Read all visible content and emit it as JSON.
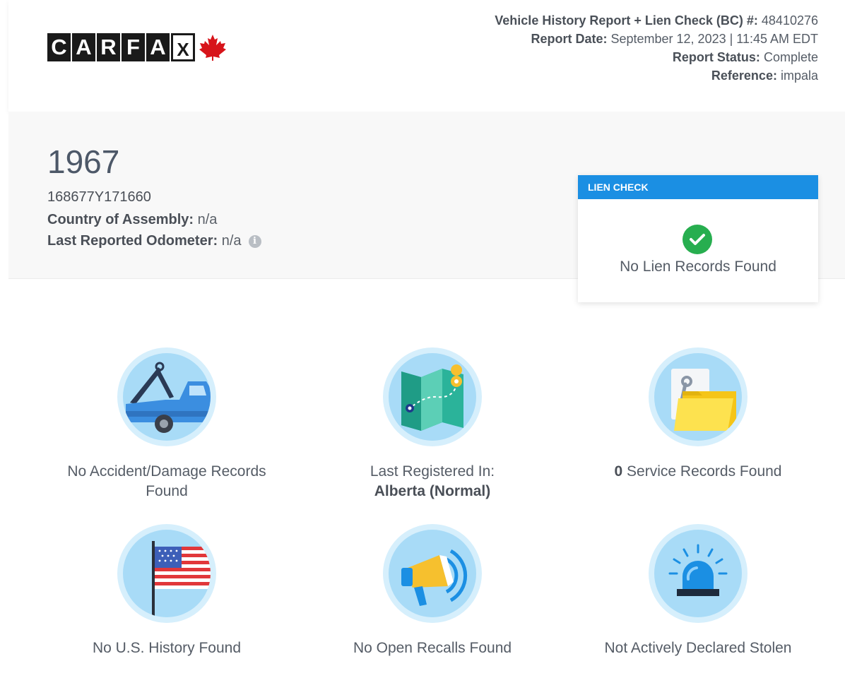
{
  "header": {
    "logo": {
      "letters": [
        "C",
        "A",
        "R",
        "F",
        "A",
        "X"
      ],
      "maple_leaf_color": "#d7141a"
    },
    "report_number_label": "Vehicle History Report + Lien Check (BC) #:",
    "report_number": "48410276",
    "report_date_label": "Report Date:",
    "report_date": "September 12, 2023 | 11:45 AM EDT",
    "report_status_label": "Report Status:",
    "report_status": "Complete",
    "reference_label": "Reference:",
    "reference": "impala"
  },
  "vehicle": {
    "year": "1967",
    "vin": "168677Y171660",
    "country_label": "Country of Assembly:",
    "country": "n/a",
    "odometer_label": "Last Reported Odometer:",
    "odometer": "n/a",
    "info_icon": "info-icon"
  },
  "lien_check": {
    "title": "LIEN CHECK",
    "status_icon": "check-circle-icon",
    "status_text": "No Lien Records Found",
    "accent_color": "#1b8fe3",
    "ok_color": "#27ae4f"
  },
  "cards": [
    {
      "icon": "tow-truck-icon",
      "line1": "No Accident/Damage Records",
      "line2": "Found"
    },
    {
      "icon": "map-icon",
      "line1": "Last Registered In:",
      "line2_bold": "Alberta (Normal)"
    },
    {
      "icon": "service-folder-icon",
      "count": "0",
      "text": "Service Records Found"
    },
    {
      "icon": "us-flag-icon",
      "text": "No U.S. History Found"
    },
    {
      "icon": "megaphone-icon",
      "text": "No Open Recalls Found"
    },
    {
      "icon": "police-siren-icon",
      "text": "Not Actively Declared Stolen"
    }
  ]
}
